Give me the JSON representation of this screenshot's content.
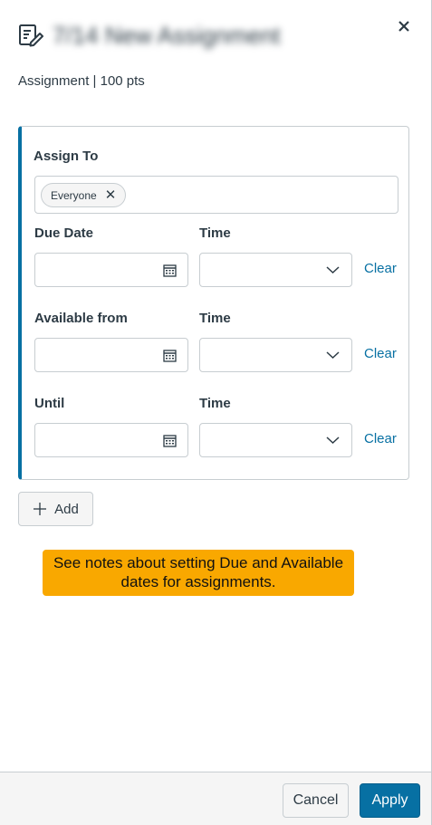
{
  "header": {
    "title": "7/14 New Assignment",
    "icon": "assignment-edit-icon",
    "close_label": "✕"
  },
  "subtitle": "Assignment | 100 pts",
  "card": {
    "assign_to_label": "Assign To",
    "assignee_chip": "Everyone",
    "rows": [
      {
        "date_label": "Due Date",
        "time_label": "Time",
        "date_value": "",
        "time_value": "",
        "clear_label": "Clear"
      },
      {
        "date_label": "Available from",
        "time_label": "Time",
        "date_value": "",
        "time_value": "",
        "clear_label": "Clear"
      },
      {
        "date_label": "Until",
        "time_label": "Time",
        "date_value": "",
        "time_value": "",
        "clear_label": "Clear"
      }
    ],
    "accent_color": "#0770a3"
  },
  "add_button_label": "Add",
  "note": "See notes about setting Due and Available dates for assignments.",
  "note_color": "#f9a800",
  "footer": {
    "cancel_label": "Cancel",
    "apply_label": "Apply",
    "apply_color": "#0770a3"
  }
}
